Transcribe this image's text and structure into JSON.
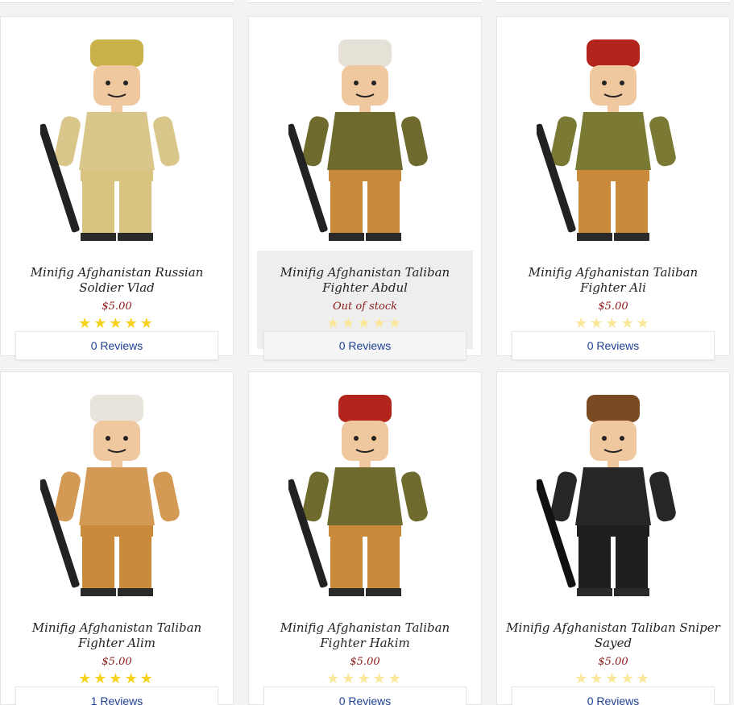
{
  "products": [
    {
      "title": "Minifig Afghanistan Russian Soldier Vlad",
      "price": "$5.00",
      "reviews": "0 Reviews",
      "image": "minifig-russian-soldier-vlad",
      "stars": 5,
      "hat": "#c9b24a",
      "torso": "#d9c68a",
      "legs": "#d8c47e",
      "gun": "#222222"
    },
    {
      "title": "Minifig Afghanistan Taliban Fighter Abdul",
      "price": "Out of stock",
      "reviews": "0 Reviews",
      "image": "minifig-taliban-fighter-abdul",
      "stars": 5,
      "hat": "#e6e1d6",
      "torso": "#6f6b2e",
      "legs": "#c98a3b",
      "gun": "#222222"
    },
    {
      "title": "Minifig Afghanistan Taliban Fighter Ali",
      "price": "$5.00",
      "reviews": "0 Reviews",
      "image": "minifig-taliban-fighter-ali",
      "stars": 5,
      "hat": "#b3241c",
      "torso": "#7a7a34",
      "legs": "#c98a3b",
      "gun": "#222222"
    },
    {
      "title": "Minifig Afghanistan Taliban Fighter Alim",
      "price": "$5.00",
      "reviews": "1 Reviews",
      "image": "minifig-taliban-fighter-alim",
      "stars": 5,
      "hat": "#e8e4dc",
      "torso": "#d39a55",
      "legs": "#c98a3b",
      "gun": "#222222"
    },
    {
      "title": "Minifig Afghanistan Taliban Fighter Hakim",
      "price": "$5.00",
      "reviews": "0 Reviews",
      "image": "minifig-taliban-fighter-hakim",
      "stars": 5,
      "hat": "#b3241c",
      "torso": "#6f6b2e",
      "legs": "#c98a3b",
      "gun": "#222222"
    },
    {
      "title": "Minifig Afghanistan Taliban Sniper Sayed",
      "price": "$5.00",
      "reviews": "0 Reviews",
      "image": "minifig-taliban-sniper-sayed",
      "stars": 5,
      "hat": "#7a4a22",
      "torso": "#262626",
      "legs": "#1e1e1e",
      "gun": "#111111"
    }
  ],
  "colors": {
    "price": "#8b1a1a",
    "link": "#1c3f94",
    "star": "#f7d21c",
    "skin": "#f0c8a0"
  }
}
